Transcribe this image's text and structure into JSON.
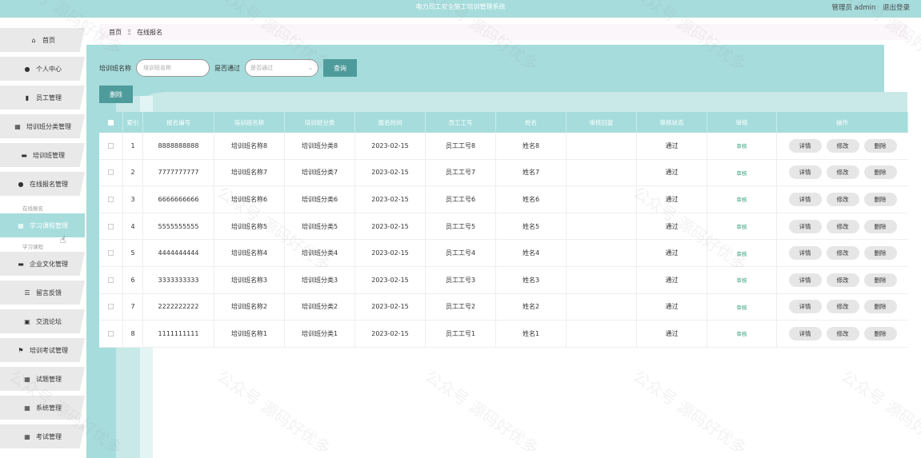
{
  "header": {
    "system_title": "电力司工安全施工培训管理系统",
    "user_label": "管理员 admin",
    "logout_label": "退出登录"
  },
  "sidebar": {
    "items": [
      {
        "label": "首页",
        "icon": "home-icon",
        "glyph": "⌂"
      },
      {
        "label": "个人中心",
        "icon": "user-icon",
        "glyph": "●"
      },
      {
        "label": "员工管理",
        "icon": "bar-chart-icon",
        "glyph": "▮"
      },
      {
        "label": "培训班分类管理",
        "icon": "grid-icon",
        "glyph": "▦"
      },
      {
        "label": "培训班管理",
        "icon": "monitor-icon",
        "glyph": "▬"
      },
      {
        "label": "在线报名管理",
        "icon": "user-icon",
        "glyph": "●"
      },
      {
        "label": "学习课程管理",
        "icon": "grid-icon",
        "glyph": "▦"
      },
      {
        "label": "企业文化管理",
        "icon": "monitor-icon",
        "glyph": "▬"
      },
      {
        "label": "留言反馈",
        "icon": "list-icon",
        "glyph": "☰"
      },
      {
        "label": "交流论坛",
        "icon": "calendar-check-icon",
        "glyph": "▣"
      },
      {
        "label": "培训考试管理",
        "icon": "flag-icon",
        "glyph": "⚑"
      },
      {
        "label": "试题管理",
        "icon": "grid-icon",
        "glyph": "▦"
      },
      {
        "label": "系统管理",
        "icon": "grid-icon",
        "glyph": "▦"
      },
      {
        "label": "考试管理",
        "icon": "grid-icon",
        "glyph": "▦"
      }
    ],
    "active_index": 6,
    "sub_peek_top": "在线报名",
    "sub_peek_bottom": "学习课程"
  },
  "breadcrumb": {
    "home": "首页",
    "separator": "Ξ",
    "current": "在线报名"
  },
  "search": {
    "class_name_label": "培训班名称",
    "class_name_placeholder": "培训班名称",
    "passed_label": "是否通过",
    "passed_placeholder": "是否通过",
    "query_button": "查询"
  },
  "toolbar": {
    "delete_button": "删除"
  },
  "table": {
    "columns": [
      "",
      "索引",
      "报名编号",
      "培训班名称",
      "培训班分类",
      "报名时间",
      "员工工号",
      "姓名",
      "审核回复",
      "审核状态",
      "审核",
      "操作"
    ],
    "rows": [
      {
        "index": "1",
        "code": "8888888888",
        "class_name": "培训班名称8",
        "category": "培训班分类8",
        "date": "2023-02-15",
        "emp_no": "员工工号8",
        "name": "姓名8",
        "reply": "",
        "status": "通过",
        "audit": "审核"
      },
      {
        "index": "2",
        "code": "7777777777",
        "class_name": "培训班名称7",
        "category": "培训班分类7",
        "date": "2023-02-15",
        "emp_no": "员工工号7",
        "name": "姓名7",
        "reply": "",
        "status": "通过",
        "audit": "审核"
      },
      {
        "index": "3",
        "code": "6666666666",
        "class_name": "培训班名称6",
        "category": "培训班分类6",
        "date": "2023-02-15",
        "emp_no": "员工工号6",
        "name": "姓名6",
        "reply": "",
        "status": "通过",
        "audit": "审核"
      },
      {
        "index": "4",
        "code": "5555555555",
        "class_name": "培训班名称5",
        "category": "培训班分类5",
        "date": "2023-02-15",
        "emp_no": "员工工号5",
        "name": "姓名5",
        "reply": "",
        "status": "通过",
        "audit": "审核"
      },
      {
        "index": "5",
        "code": "4444444444",
        "class_name": "培训班名称4",
        "category": "培训班分类4",
        "date": "2023-02-15",
        "emp_no": "员工工号4",
        "name": "姓名4",
        "reply": "",
        "status": "通过",
        "audit": "审核"
      },
      {
        "index": "6",
        "code": "3333333333",
        "class_name": "培训班名称3",
        "category": "培训班分类3",
        "date": "2023-02-15",
        "emp_no": "员工工号3",
        "name": "姓名3",
        "reply": "",
        "status": "通过",
        "audit": "审核"
      },
      {
        "index": "7",
        "code": "2222222222",
        "class_name": "培训班名称2",
        "category": "培训班分类2",
        "date": "2023-02-15",
        "emp_no": "员工工号2",
        "name": "姓名2",
        "reply": "",
        "status": "通过",
        "audit": "审核"
      },
      {
        "index": "8",
        "code": "1111111111",
        "class_name": "培训班名称1",
        "category": "培训班分类1",
        "date": "2023-02-15",
        "emp_no": "员工工号1",
        "name": "姓名1",
        "reply": "",
        "status": "通过",
        "audit": "审核"
      }
    ],
    "row_actions": [
      "详情",
      "修改",
      "删除"
    ]
  },
  "watermark": "公众号 源码好优多",
  "colors": {
    "accent": "#a6dcdc",
    "button": "#4e9b9b",
    "audit_link": "#3aa37c"
  }
}
